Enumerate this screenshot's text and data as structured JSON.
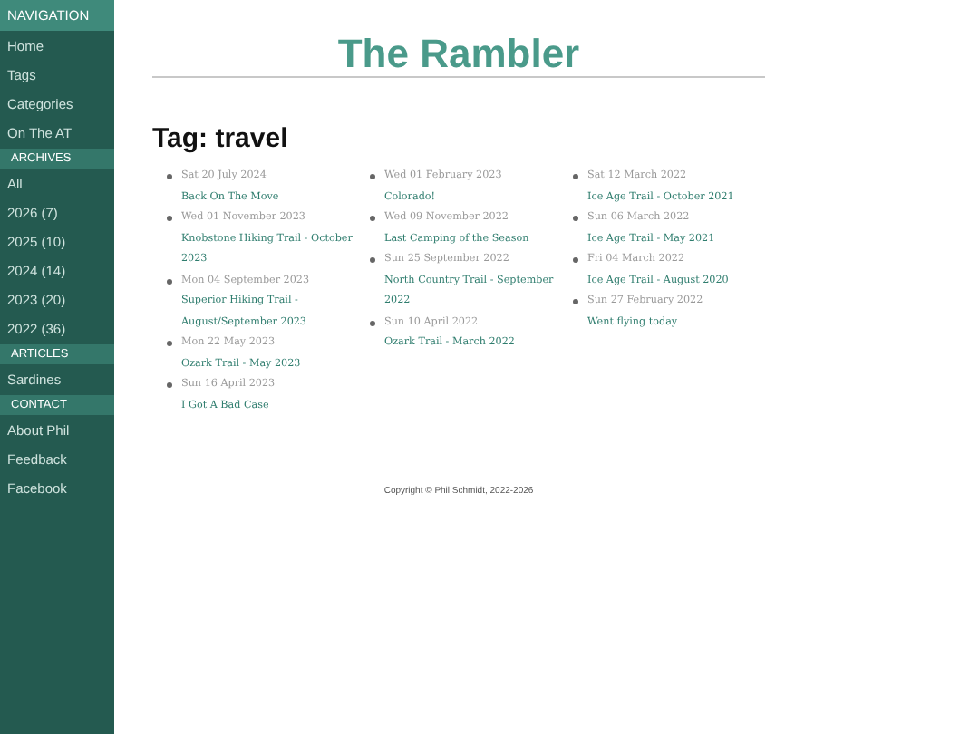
{
  "sidebar": {
    "sections": [
      {
        "title": "NAVIGATION",
        "items": [
          "Home",
          "Tags",
          "Categories",
          "On The AT"
        ]
      },
      {
        "title": "ARCHIVES",
        "items": [
          "All",
          "2026 (7)",
          "2025 (10)",
          "2024 (14)",
          "2023 (20)",
          "2022 (36)"
        ]
      },
      {
        "title": "ARTICLES",
        "items": [
          "Sardines"
        ]
      },
      {
        "title": "CONTACT",
        "items": [
          "About Phil",
          "Feedback",
          "Facebook"
        ]
      }
    ]
  },
  "site_title": "The Rambler",
  "page_heading": "Tag: travel",
  "columns": [
    [
      {
        "date": "Sat 20 July 2024",
        "title": "Back On The Move"
      },
      {
        "date": "Wed 01 November 2023",
        "title": "Knobstone Hiking Trail - October 2023"
      },
      {
        "date": "Mon 04 September 2023",
        "title": "Superior Hiking Trail - August/September 2023"
      },
      {
        "date": "Mon 22 May 2023",
        "title": "Ozark Trail - May 2023"
      },
      {
        "date": "Sun 16 April 2023",
        "title": "I Got A Bad Case"
      }
    ],
    [
      {
        "date": "Wed 01 February 2023",
        "title": "Colorado!"
      },
      {
        "date": "Wed 09 November 2022",
        "title": "Last Camping of the Season"
      },
      {
        "date": "Sun 25 September 2022",
        "title": "North Country Trail - September 2022"
      },
      {
        "date": "Sun 10 April 2022",
        "title": "Ozark Trail - March 2022"
      }
    ],
    [
      {
        "date": "Sat 12 March 2022",
        "title": "Ice Age Trail - October 2021"
      },
      {
        "date": "Sun 06 March 2022",
        "title": "Ice Age Trail - May 2021"
      },
      {
        "date": "Fri 04 March 2022",
        "title": "Ice Age Trail - August 2020"
      },
      {
        "date": "Sun 27 February 2022",
        "title": "Went flying today"
      }
    ]
  ],
  "footer": "Copyright © Phil Schmidt, 2022-2026"
}
